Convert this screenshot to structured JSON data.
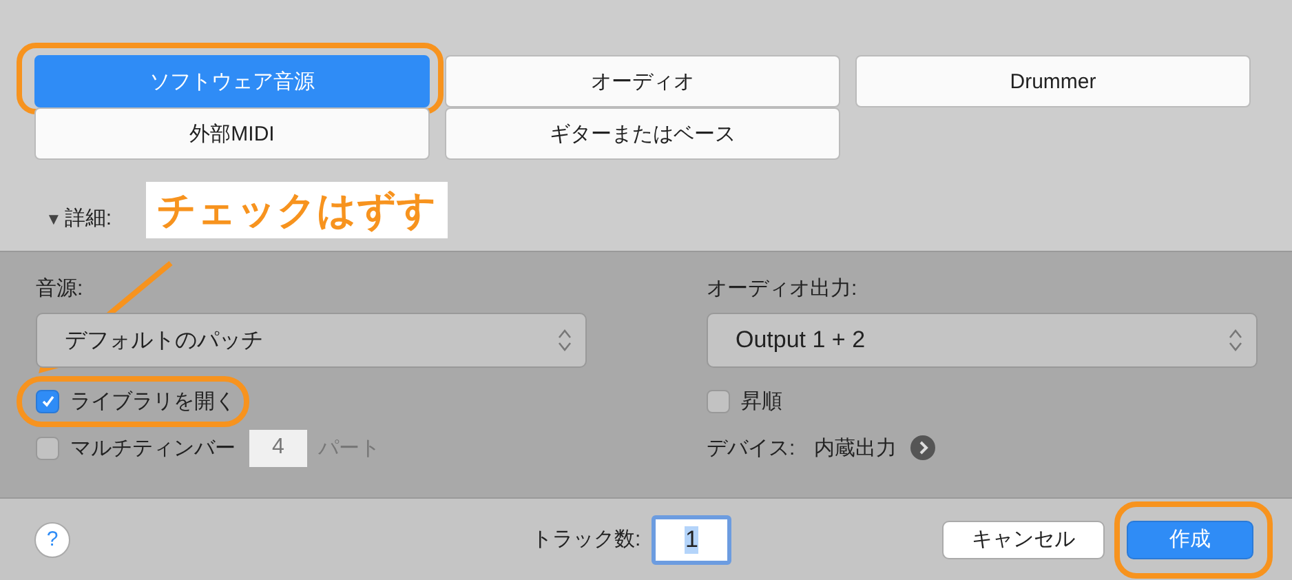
{
  "track_types": [
    {
      "label": "ソフトウェア音源",
      "selected": true,
      "highlighted": true
    },
    {
      "label": "オーディオ",
      "selected": false,
      "highlighted": false
    },
    {
      "label": "Drummer",
      "selected": false,
      "highlighted": false
    },
    {
      "label": "外部MIDI",
      "selected": false,
      "highlighted": false
    },
    {
      "label": "ギターまたはベース",
      "selected": false,
      "highlighted": false
    }
  ],
  "details": {
    "toggle": "▼",
    "label": "詳細:"
  },
  "callout": {
    "text": "チェックはずす"
  },
  "instrument": {
    "label": "音源:",
    "value": "デフォルトのパッチ"
  },
  "open_library": {
    "label": "ライブラリを開く",
    "checked": true,
    "highlighted": true
  },
  "multitimbral": {
    "label": "マルチティンバー",
    "checked": false,
    "parts": "4",
    "unit": "パート",
    "disabled": true
  },
  "audio_output": {
    "label": "オーディオ出力:",
    "value": "Output 1 + 2"
  },
  "ascending": {
    "label": "昇順",
    "checked": false
  },
  "device": {
    "label": "デバイス:",
    "value": "内蔵出力"
  },
  "footer": {
    "help": "?",
    "track_count_label": "トラック数:",
    "track_count": "1"
  },
  "buttons": [
    {
      "label": "キャンセル",
      "kind": "secondary",
      "highlighted": false
    },
    {
      "label": "作成",
      "kind": "primary",
      "highlighted": true
    }
  ]
}
